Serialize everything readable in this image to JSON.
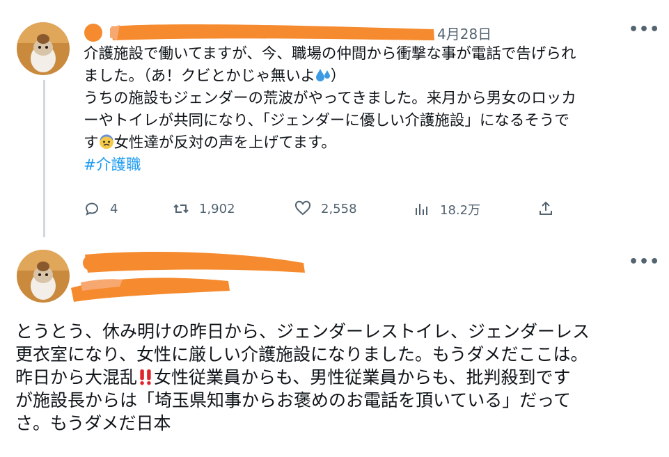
{
  "parent_tweet": {
    "date": "4月28日",
    "more_label": "•••",
    "lines": [
      "介護施設で働いてますが、今、職場の仲間から衝撃な事が電話で告げられ",
      "ました。（あ！クビとかじゃ無いよ",
      "）",
      "うちの施設もジェンダーの荒波がやってきました。来月から男女のロッカ",
      "ーやトイレが共同になり、「ジェンダーに優しい介護施設」になるそうで",
      "す",
      "女性達が反対の声を上げてます。"
    ],
    "hashtag": "#介護職",
    "stats": {
      "replies": "4",
      "retweets": "1,902",
      "likes": "2,558",
      "views": "18.2万"
    },
    "icons": {
      "reply": "reply-icon",
      "retweet": "retweet-icon",
      "like": "heart-icon",
      "views": "views-icon",
      "share": "share-icon",
      "sweat_emoji": "sweat-droplets-emoji",
      "anxious_emoji": "anxious-face-emoji"
    }
  },
  "reply_tweet": {
    "more_label": "•••",
    "lines": [
      "とうとう、休み明けの昨日から、ジェンダーレストイレ、ジェンダーレス",
      "更衣室になり、女性に厳しい介護施設になりました。もうダメだここは。",
      "昨日から大混乱",
      "女性従業員からも、男性従業員からも、批判殺到です",
      "が施設長からは「埼玉県知事からお褒めのお電話を頂いている」だって",
      "さ。もうダメだ日本"
    ],
    "icons": {
      "exclamation_emoji": "double-exclamation-emoji"
    }
  },
  "colors": {
    "redaction": "#f58a2e",
    "hashtag": "#1d9bf0",
    "secondary": "#536471",
    "thread_line": "#cfd9de"
  }
}
